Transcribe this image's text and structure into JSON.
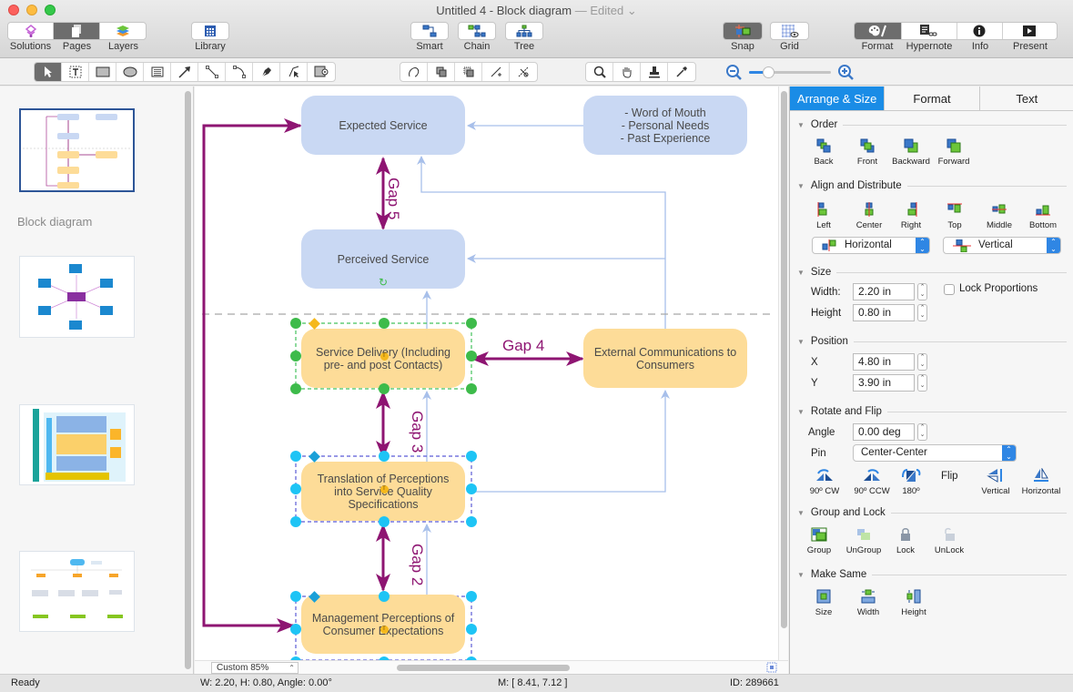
{
  "window": {
    "title": "Untitled 4 - Block diagram",
    "edited": "— Edited ⌄"
  },
  "toolbar": {
    "left_segment": [
      {
        "label": "Solutions",
        "icon": "solutions-icon",
        "active": false
      },
      {
        "label": "Pages",
        "icon": "pages-icon",
        "active": true
      },
      {
        "label": "Layers",
        "icon": "layers-icon",
        "active": false
      }
    ],
    "library": {
      "label": "Library",
      "icon": "library-icon"
    },
    "connectors": [
      {
        "label": "Smart",
        "icon": "smart-connector-icon"
      },
      {
        "label": "Chain",
        "icon": "chain-connector-icon"
      },
      {
        "label": "Tree",
        "icon": "tree-connector-icon"
      }
    ],
    "snap": {
      "label": "Snap",
      "active": true
    },
    "grid": {
      "label": "Grid",
      "active": false
    },
    "right_segment": [
      {
        "label": "Format",
        "icon": "format-icon",
        "active": true
      },
      {
        "label": "Hypernote",
        "icon": "hypernote-icon",
        "active": false
      },
      {
        "label": "Info",
        "icon": "info-icon",
        "active": false
      },
      {
        "label": "Present",
        "icon": "present-icon",
        "active": false
      }
    ]
  },
  "drawing_tools": {
    "shapes": [
      "select-tool",
      "text-box-tool",
      "rectangle-tool",
      "ellipse-tool",
      "text-block-tool",
      "arrow-tool",
      "line-tool",
      "arc-tool",
      "pen-tool",
      "bezier-tool",
      "shape-insert-tool"
    ],
    "edit": [
      "curve-edit-tool",
      "group-edit-tool",
      "ungroup-edit-tool",
      "add-point-tool",
      "split-tool"
    ],
    "view": [
      "zoom-tool",
      "hand-tool",
      "stamp-tool",
      "eyedropper-tool"
    ],
    "zoom_slider_fraction": 0.2
  },
  "sidebar": {
    "page_label": "Block diagram",
    "pages": [
      {
        "name": "page-thumbnail-1",
        "selected": true
      },
      {
        "name": "page-thumbnail-2",
        "selected": false
      },
      {
        "name": "page-thumbnail-3",
        "selected": false
      },
      {
        "name": "page-thumbnail-4",
        "selected": false
      }
    ]
  },
  "diagram": {
    "nodes": {
      "expected": "Expected Service",
      "sources": "- Word of Mouth\n- Personal Needs\n- Past Experience",
      "perceived": "Perceived Service",
      "delivery": "Service Delivery (Including pre- and post Contacts)",
      "external": "External Communications to Consumers",
      "translation": "Translation of Perceptions into Service Quality Specifications",
      "management": "Management Perceptions of Consumer Expectations"
    },
    "gaps": {
      "gap5": "Gap 5",
      "gap4": "Gap 4",
      "gap3": "Gap 3",
      "gap2": "Gap 2"
    },
    "colors": {
      "blue_node": "#c9d8f3",
      "orange_node": "#fddc98",
      "gap_arrow": "#8e1572",
      "connector": "#a7bfea"
    }
  },
  "canvas_footer": {
    "zoom": "Custom 85%"
  },
  "panel": {
    "tabs": [
      {
        "label": "Arrange & Size",
        "active": true
      },
      {
        "label": "Format",
        "active": false
      },
      {
        "label": "Text",
        "active": false
      }
    ],
    "order": {
      "title": "Order",
      "buttons": [
        "Back",
        "Front",
        "Backward",
        "Forward"
      ]
    },
    "align": {
      "title": "Align and Distribute",
      "buttons": [
        "Left",
        "Center",
        "Right",
        "Top",
        "Middle",
        "Bottom"
      ],
      "horizontal": "Horizontal",
      "vertical": "Vertical"
    },
    "size": {
      "title": "Size",
      "width_label": "Width:",
      "width": "2.20 in",
      "height_label": "Height",
      "height": "0.80 in",
      "lock_label": "Lock Proportions",
      "lock_checked": false
    },
    "position": {
      "title": "Position",
      "x_label": "X",
      "x": "4.80 in",
      "y_label": "Y",
      "y": "3.90 in"
    },
    "rotate": {
      "title": "Rotate and Flip",
      "angle_label": "Angle",
      "angle": "0.00 deg",
      "pin_label": "Pin",
      "pin": "Center-Center",
      "buttons": [
        "90º CW",
        "90º CCW",
        "180º"
      ],
      "flip_label": "Flip",
      "flip_buttons": [
        "Vertical",
        "Horizontal"
      ]
    },
    "group": {
      "title": "Group and Lock",
      "buttons": [
        "Group",
        "UnGroup",
        "Lock",
        "UnLock"
      ]
    },
    "same": {
      "title": "Make Same",
      "buttons": [
        "Size",
        "Width",
        "Height"
      ]
    }
  },
  "status": {
    "state": "Ready",
    "dims": "W: 2.20,  H: 0.80,  Angle: 0.00°",
    "mouse": "M: [ 8.41, 7.12 ]",
    "id": "ID: 289661"
  }
}
